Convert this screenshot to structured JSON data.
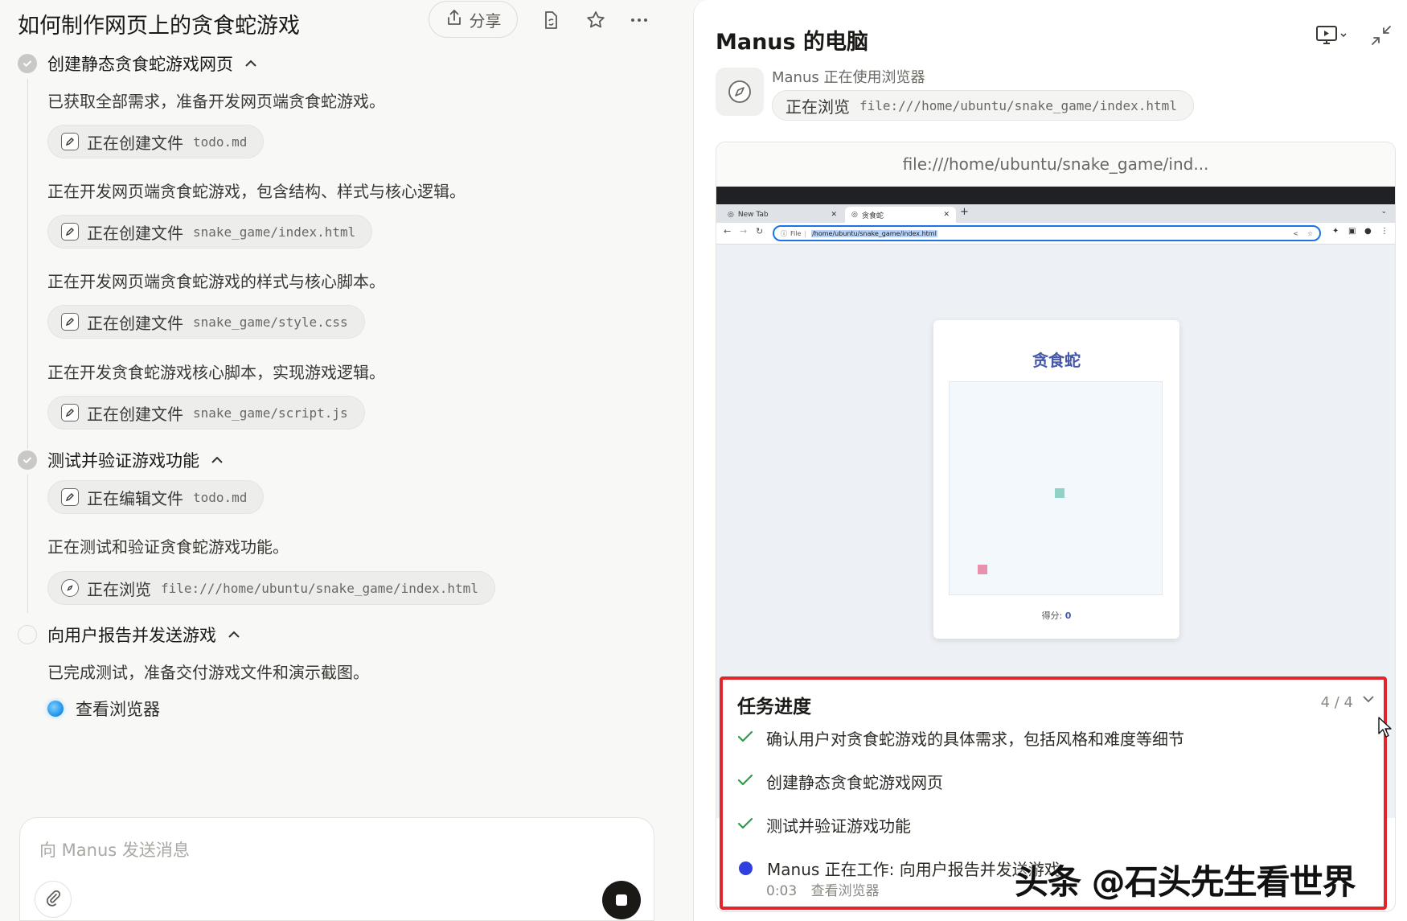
{
  "left": {
    "title": "如何制作网页上的贪食蛇游戏",
    "share_label": "分享",
    "steps": [
      {
        "title": "创建静态贪食蛇游戏网页",
        "items": [
          {
            "type": "msg",
            "text": "已获取全部需求，准备开发网页端贪食蛇游戏。"
          },
          {
            "type": "chip",
            "label": "正在创建文件",
            "arg": "todo.md",
            "icon": "edit-file-icon"
          },
          {
            "type": "msg",
            "text": "正在开发网页端贪食蛇游戏，包含结构、样式与核心逻辑。"
          },
          {
            "type": "chip",
            "label": "正在创建文件",
            "arg": "snake_game/index.html",
            "icon": "edit-file-icon"
          },
          {
            "type": "msg",
            "text": "正在开发网页端贪食蛇游戏的样式与核心脚本。"
          },
          {
            "type": "chip",
            "label": "正在创建文件",
            "arg": "snake_game/style.css",
            "icon": "edit-file-icon"
          },
          {
            "type": "msg",
            "text": "正在开发贪食蛇游戏核心脚本，实现游戏逻辑。"
          },
          {
            "type": "chip",
            "label": "正在创建文件",
            "arg": "snake_game/script.js",
            "icon": "edit-file-icon"
          }
        ]
      },
      {
        "title": "测试并验证游戏功能",
        "items": [
          {
            "type": "chip",
            "label": "正在编辑文件",
            "arg": "todo.md",
            "icon": "edit-file-icon"
          },
          {
            "type": "msg",
            "text": "正在测试和验证贪食蛇游戏功能。"
          },
          {
            "type": "chip",
            "label": "正在浏览",
            "arg": "file:///home/ubuntu/snake_game/index.html",
            "icon": "compass-icon"
          }
        ]
      },
      {
        "title": "向用户报告并发送游戏",
        "items": [
          {
            "type": "msg",
            "text": "已完成测试，准备交付游戏文件和演示截图。"
          }
        ]
      }
    ],
    "view_browser": "查看浏览器",
    "input_placeholder": "向 Manus 发送消息"
  },
  "right": {
    "title": "Manus 的电脑",
    "agent_status": "Manus 正在使用浏览器",
    "agent_action": "正在浏览",
    "agent_arg": "file:///home/ubuntu/snake_game/index.html",
    "screen_url": "file:///home/ubuntu/snake_game/ind...",
    "vm": {
      "tab1": "New Tab",
      "tab2": "贪食蛇",
      "addr_prefix": "File",
      "addr_path": "/home/ubuntu/snake_game/index.html"
    },
    "game": {
      "title": "贪食蛇",
      "score_label": "得分:",
      "score_value": "0",
      "food_color": "#e891ad",
      "snake_color": "#8fd3c7"
    },
    "progress": {
      "title": "任务进度",
      "count": "4 / 4",
      "items": [
        {
          "text": "确认用户对贪食蛇游戏的具体需求，包括风格和难度等细节",
          "status": "done"
        },
        {
          "text": "创建静态贪食蛇游戏网页",
          "status": "done"
        },
        {
          "text": "测试并验证游戏功能",
          "status": "done"
        },
        {
          "text": "Manus 正在工作: 向用户报告并发送游戏",
          "status": "working"
        }
      ],
      "elapsed": "0:03",
      "view_browser": "查看浏览器"
    }
  },
  "watermark": "头条 @石头先生看世界",
  "colors": {
    "accent_red": "#e0262a",
    "check_green": "#2a9d48",
    "working_blue": "#2f3fe0"
  }
}
